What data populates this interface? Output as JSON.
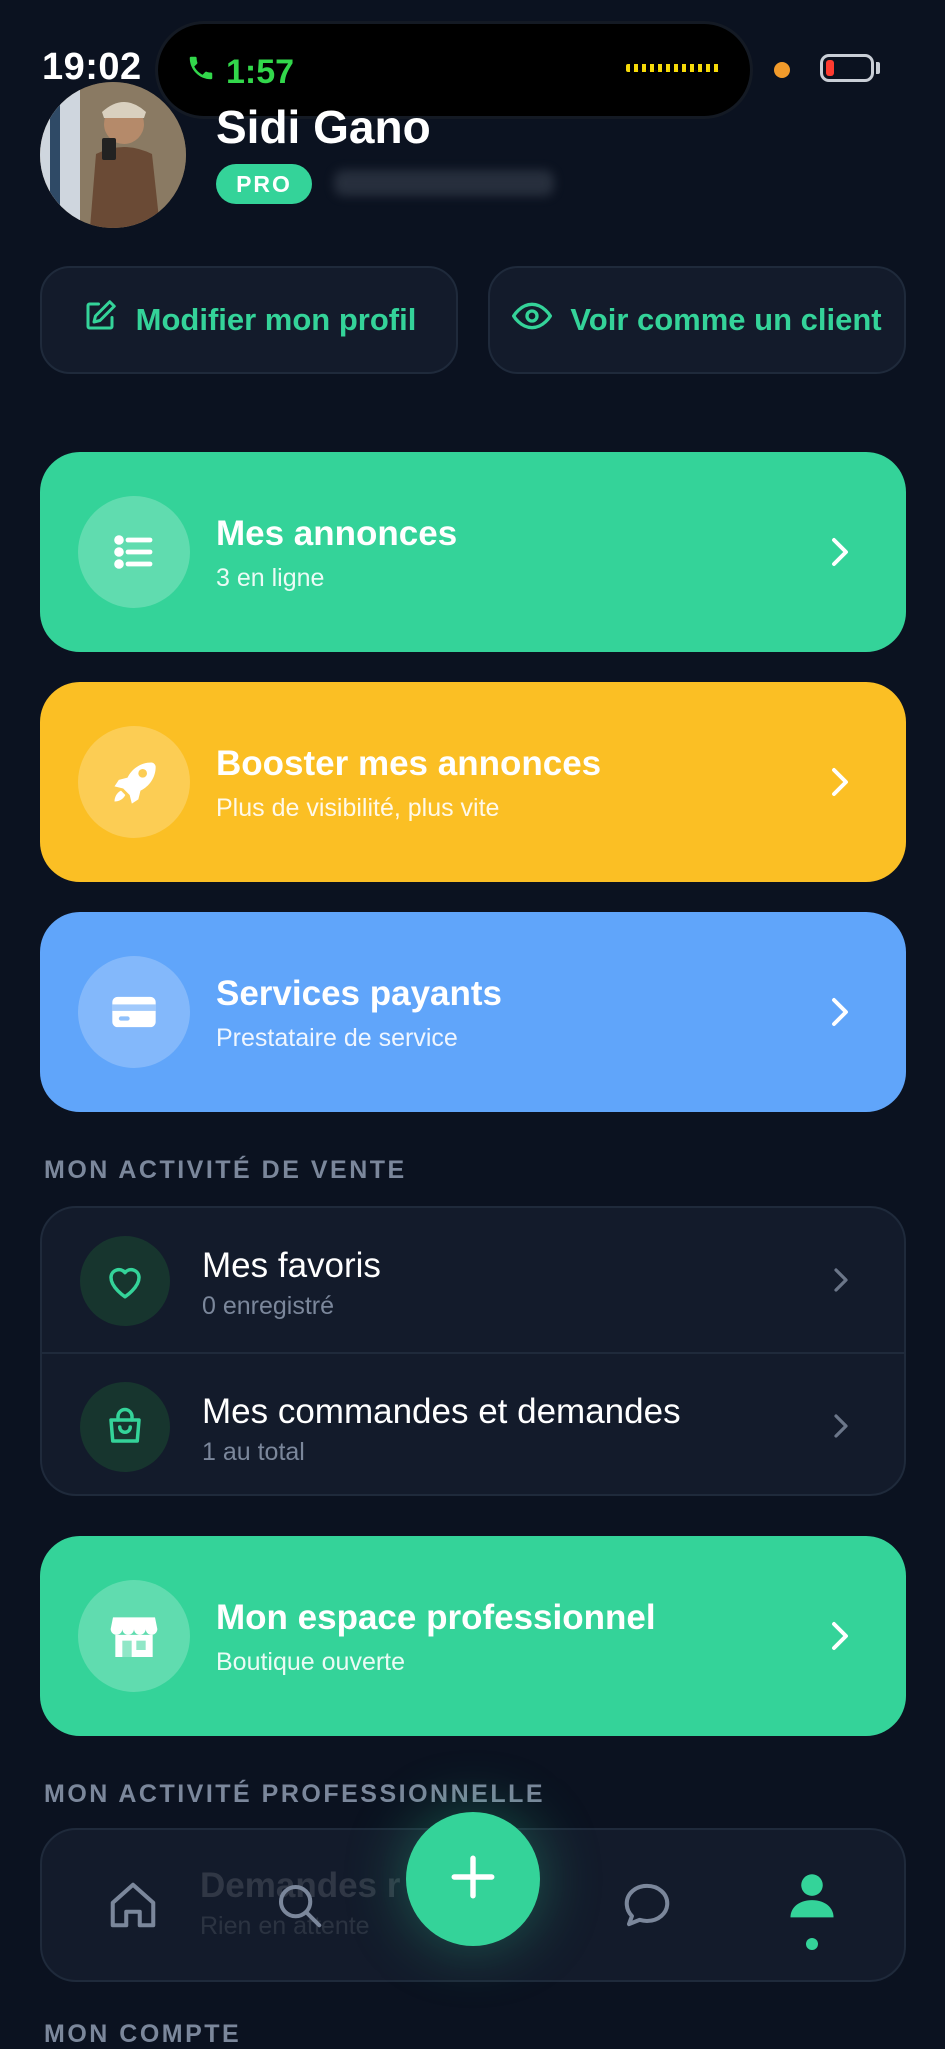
{
  "status_bar": {
    "time": "19:02",
    "call_duration": "1:57",
    "colors": {
      "call_green": "#32d74b",
      "battery_low": "#ff3b30",
      "camera_dot": "#f29b2b"
    }
  },
  "profile": {
    "name": "Sidi Gano",
    "badge": "PRO"
  },
  "actions": {
    "edit_profile": "Modifier mon profil",
    "view_as_client": "Voir comme un client"
  },
  "cards": {
    "annonces": {
      "title": "Mes annonces",
      "subtitle": "3 en ligne",
      "icon": "list-icon",
      "color": "#34d399"
    },
    "booster": {
      "title": "Booster mes annonces",
      "subtitle": "Plus de visibilité, plus vite",
      "icon": "rocket-icon",
      "color": "#fbbf24"
    },
    "services": {
      "title": "Services payants",
      "subtitle": "Prestataire de service",
      "icon": "credit-card-icon",
      "color": "#60a5fa"
    },
    "pro_space": {
      "title": "Mon espace professionnel",
      "subtitle": "Boutique ouverte",
      "icon": "store-icon",
      "color": "#34d399"
    }
  },
  "sections": {
    "sales_activity": "MON ACTIVITÉ DE VENTE",
    "pro_activity": "MON ACTIVITÉ PROFESSIONNELLE",
    "account": "MON COMPTE"
  },
  "sales_list": [
    {
      "title": "Mes favoris",
      "subtitle": "0 enregistré",
      "icon": "heart-icon"
    },
    {
      "title": "Mes commandes et demandes",
      "subtitle": "1 au total",
      "icon": "shopping-bag-icon"
    }
  ],
  "pro_list_partial": {
    "title": "Demandes r",
    "subtitle": "Rien en attente"
  },
  "bottom_nav": {
    "items": [
      "home-icon",
      "search-icon",
      "add-icon",
      "chat-icon",
      "profile-icon"
    ],
    "active": "profile-icon",
    "accent": "#34d399"
  }
}
